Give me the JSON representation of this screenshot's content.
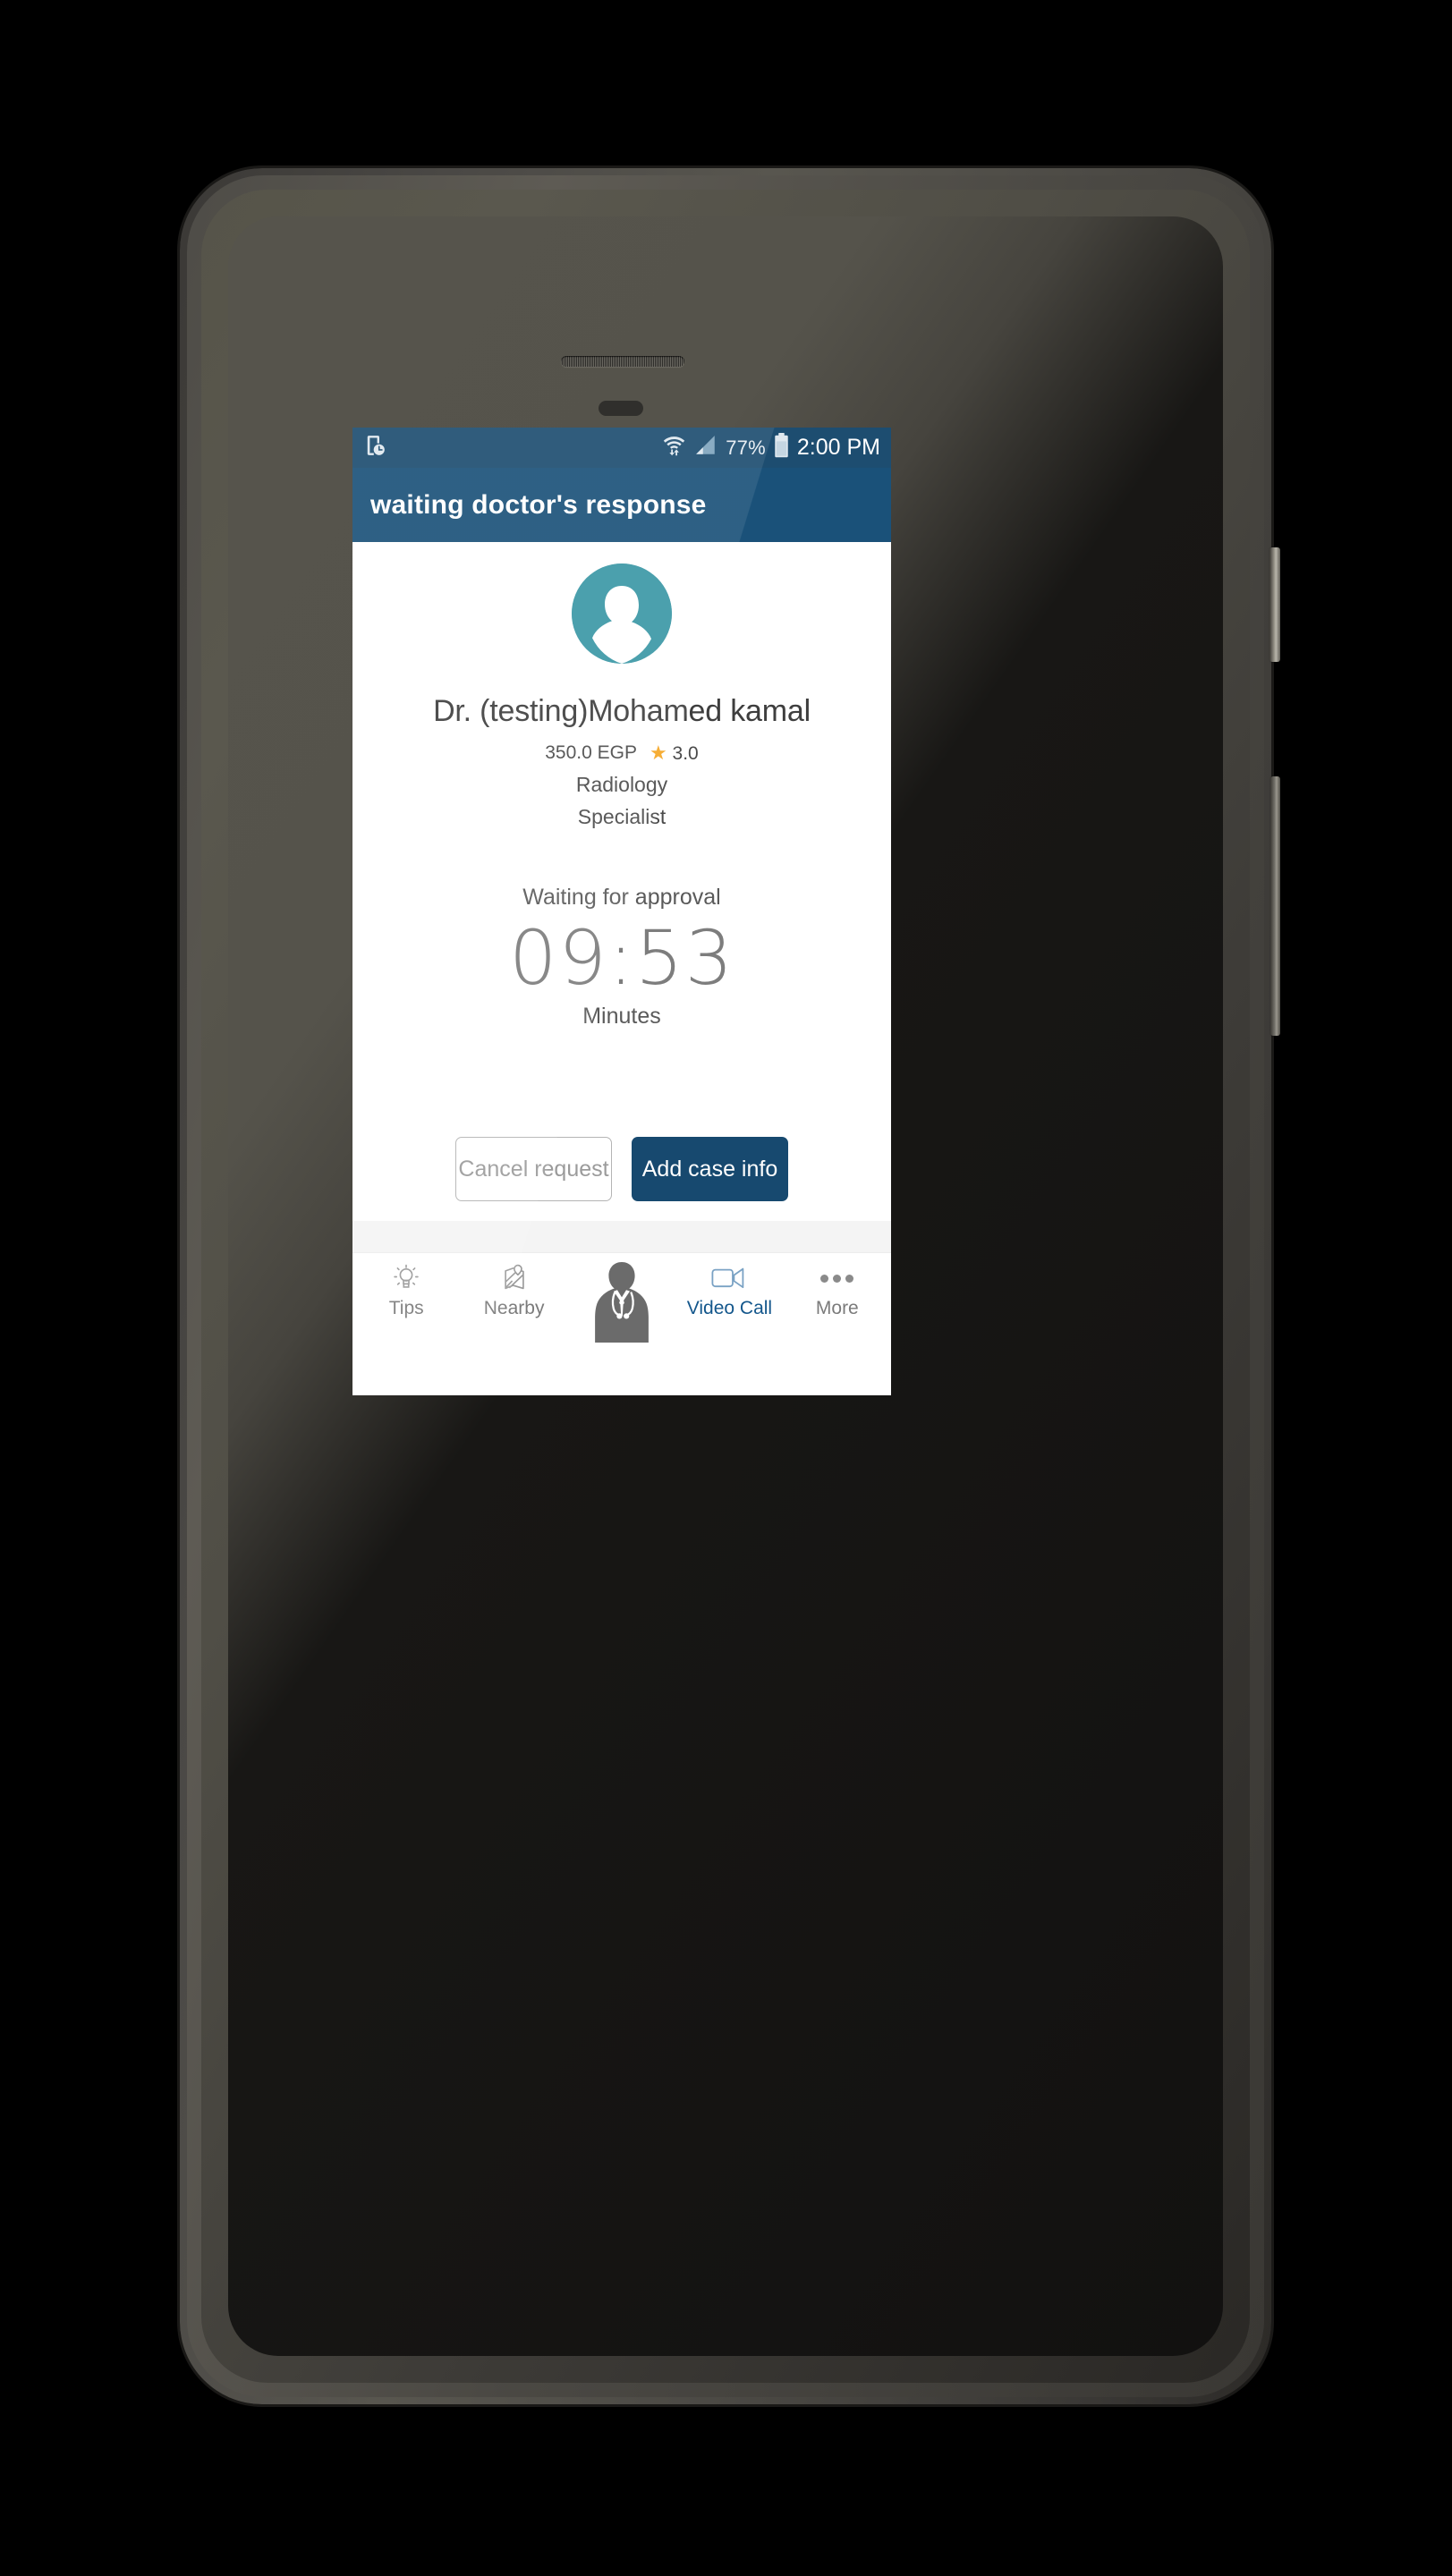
{
  "status_bar": {
    "left_icons": [
      "phone-clock-icon"
    ],
    "wifi_icon": "wifi-data-icon",
    "signal_icon": "cellular-signal-icon",
    "battery_percent": "77%",
    "battery_icon": "battery-icon",
    "time": "2:00 PM"
  },
  "app_bar": {
    "title": "waiting doctor's response",
    "background": "#1a5179"
  },
  "doctor": {
    "avatar_icon": "person-placeholder-avatar",
    "name": "Dr. (testing)Mohamed  kamal",
    "price": "350.0 EGP",
    "star_icon": "star-icon",
    "star_color": "#f5a623",
    "rating": "3.0",
    "specialty": "Radiology",
    "degree": "Specialist"
  },
  "waiting": {
    "status_text": "Waiting for approval",
    "timer": "09:53",
    "timer_unit": "Minutes"
  },
  "actions": {
    "cancel_label": "Cancel request",
    "add_case_label": "Add case info",
    "add_case_color": "#17496f"
  },
  "bottom_nav": {
    "items": [
      {
        "label": "Tips",
        "icon": "lightbulb-icon",
        "active": false
      },
      {
        "label": "Nearby",
        "icon": "map-pin-icon",
        "active": false
      },
      {
        "label": "",
        "icon": "doctor-icon",
        "active": false
      },
      {
        "label": "Video Call",
        "icon": "video-camera-icon",
        "active": true
      },
      {
        "label": "More",
        "icon": "ellipsis-icon",
        "active": false
      }
    ],
    "active_color": "#14578c"
  }
}
